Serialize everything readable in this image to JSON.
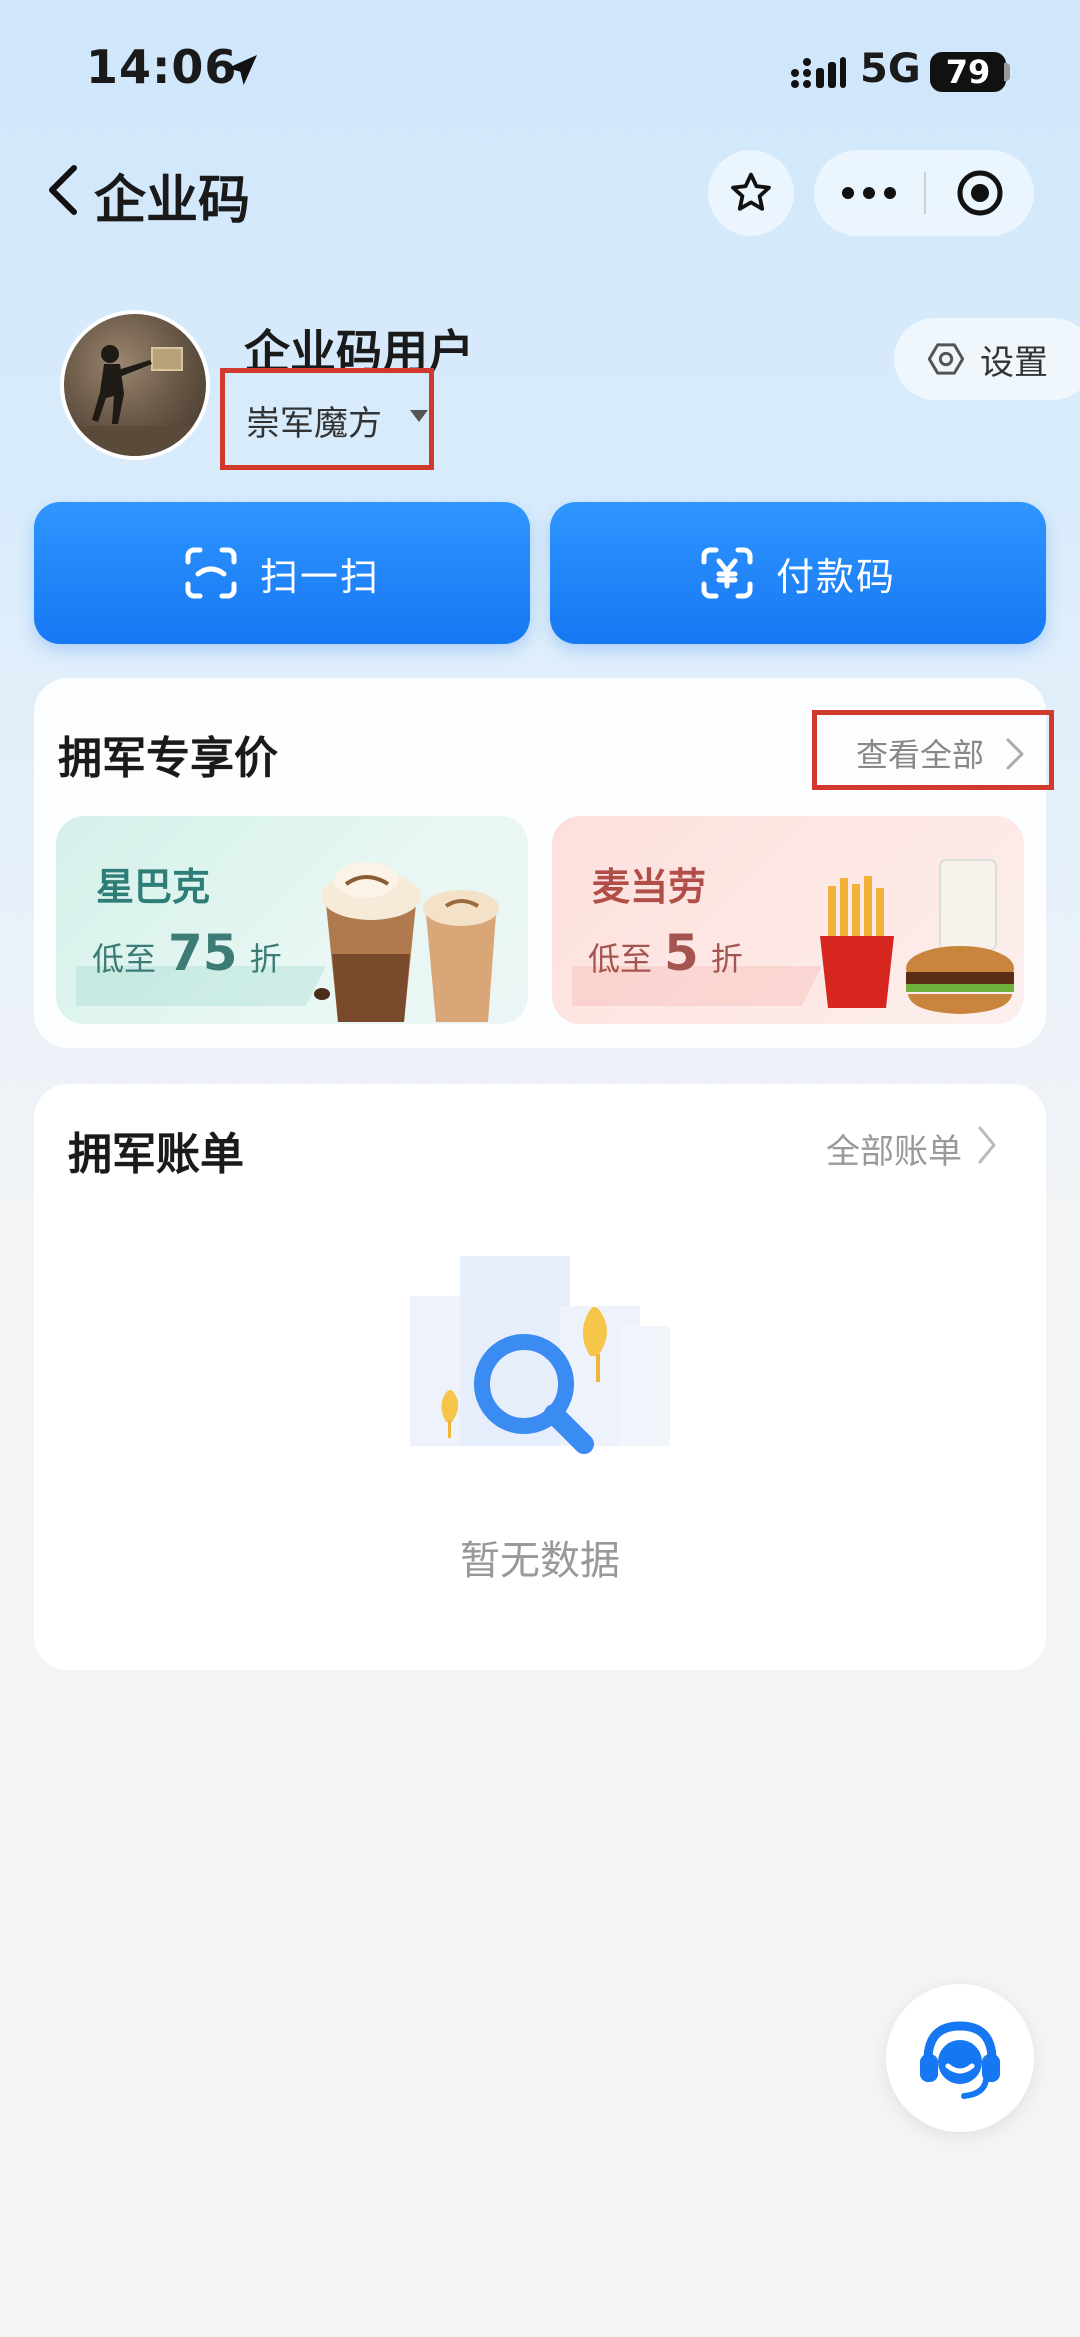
{
  "status_bar": {
    "time": "14:06",
    "network": "5G",
    "battery": "79"
  },
  "nav": {
    "title": "企业码"
  },
  "profile": {
    "user_name": "企业码用户",
    "company": "崇军魔方",
    "settings_label": "设置"
  },
  "actions": {
    "scan_label": "扫一扫",
    "pay_label": "付款码"
  },
  "deals": {
    "title": "拥军专享价",
    "view_all": "查看全部",
    "items": [
      {
        "name": "星巴克",
        "prefix": "低至",
        "value": "75",
        "suffix": "折"
      },
      {
        "name": "麦当劳",
        "prefix": "低至",
        "value": "5",
        "suffix": "折"
      }
    ]
  },
  "bills": {
    "title": "拥军账单",
    "all_bills": "全部账单",
    "empty_text": "暂无数据"
  },
  "colors": {
    "primary": "#1677f3",
    "highlight_box": "#d0392b"
  }
}
